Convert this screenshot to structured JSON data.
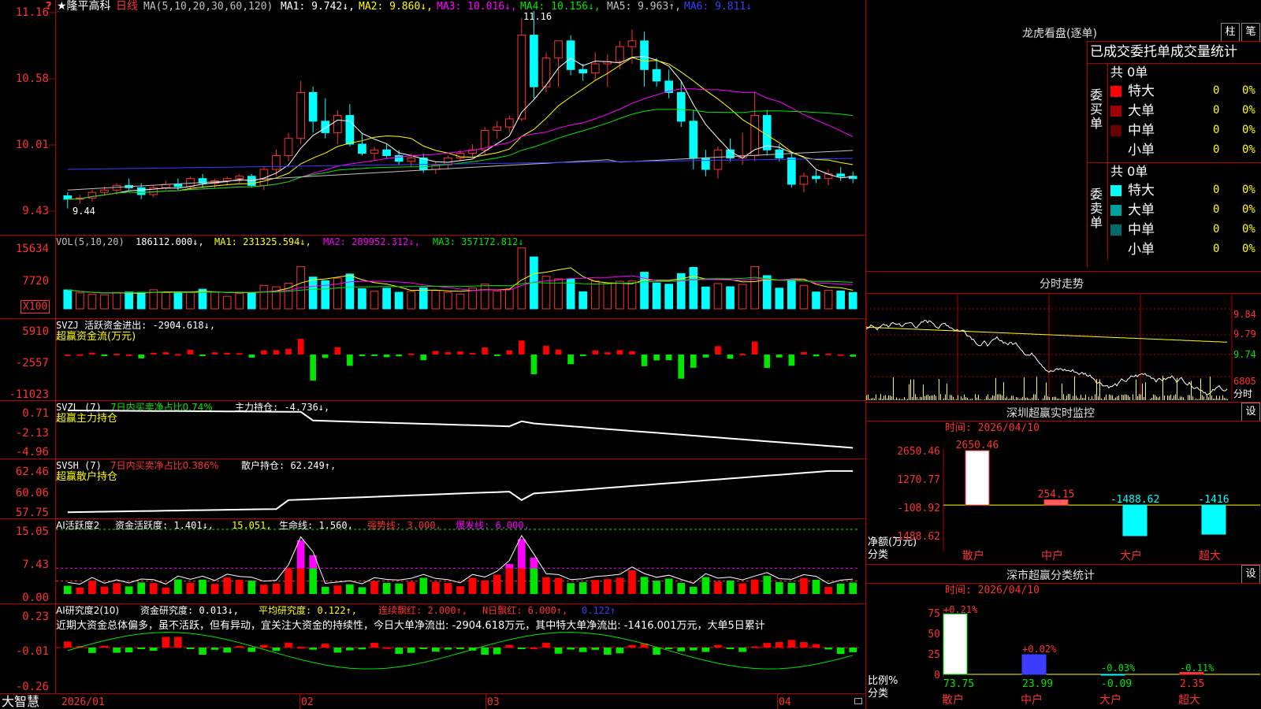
{
  "stock": {
    "name": "★隆平高科",
    "period": "日线"
  },
  "price_header": {
    "ma_params": "MA(5,10,20,30,60,120)",
    "ma1": "MA1: 9.742↓,",
    "ma2": "MA2: 9.860↓,",
    "ma3": "MA3: 10.016↓,",
    "ma4": "MA4: 10.156↓,",
    "ma5": "MA5: 9.963↑,",
    "ma6": "MA6: 9.811↓",
    "ymarks": [
      "11.16",
      "10.58",
      "10.01",
      "9.43"
    ],
    "high_label": "11.16",
    "low_label": "9.44",
    "q_mark": "?"
  },
  "vol_header": {
    "params": "VOL(5,10,20)",
    "vol": "186112.000↓,",
    "ma1": "MA1: 231325.594↓,",
    "ma2": "MA2: 289952.312↓,",
    "ma3": "MA3: 357172.812↓",
    "ymarks": [
      "15634",
      "7720"
    ],
    "unit": "X100"
  },
  "svzj": {
    "line1": "SVZJ  活跃资金进出: -2904.618↓,",
    "line2": "超赢资金流(万元)",
    "ymarks": [
      "5910",
      "-2557",
      "-11023"
    ]
  },
  "svzl": {
    "l1a": "SVZL (7)",
    "l1b": "7日内买卖净占比0.74%",
    "l1c": "主力持仓: -4.736↓,",
    "line2": "超赢主力持仓",
    "ymarks": [
      "0.71",
      "-2.13",
      "-4.96"
    ]
  },
  "svsh": {
    "l1a": "SVSH (7)",
    "l1b": "7日内买卖净占比0.386%",
    "l1c": "散户持仓: 62.249↑,",
    "line2": "超赢散户持仓",
    "ymarks": [
      "62.46",
      "60.06",
      "57.75"
    ]
  },
  "ai_active": {
    "a": "AI活跃度2",
    "b": "资金活跃度: 1.401↓,",
    "c": "15.051,",
    "d": "生命线: 1.560,",
    "e": "强势线: 3.000,",
    "f": "爆发线: 6.000,",
    "ymarks": [
      "15.05",
      "7.43",
      "0.00"
    ]
  },
  "ai_research": {
    "a": "AI研究度2(10)",
    "b": "资金研究度: 0.013↓,",
    "c": "平均研究度: 0.122↑,",
    "d": "连续飘红: 2.000↑,",
    "e": "N日飘红: 6.000↑,",
    "f": "0.122↑",
    "summary": "近期大资金总体偏多，虽不活跃，但有异动，宜关注大资金的持续性，今日大单净流出: -2904.618万元，其中特大单净流出: -1416.001万元，大单5日累计",
    "ymarks": [
      "0.23",
      "-0.01",
      "-0.26"
    ]
  },
  "xaxis": {
    "labels": [
      "2026/01",
      "02",
      "03",
      "04"
    ]
  },
  "brand": "大智慧",
  "right": {
    "dragon": {
      "title": "龙虎看盘(逐单)",
      "tab1": "柱",
      "tab2": "笔",
      "header": "已成交委托单成交量统计",
      "buy_label": "委买单",
      "sell_label": "委卖单",
      "buy_total": "共 0单",
      "sell_total": "共 0单",
      "buy_rows": [
        {
          "name": "特大",
          "val": "0",
          "pct": "0%",
          "color": "#ff0000"
        },
        {
          "name": "大单",
          "val": "0",
          "pct": "0%",
          "color": "#a00000"
        },
        {
          "name": "中单",
          "val": "0",
          "pct": "0%",
          "color": "#6a0000"
        },
        {
          "name": "小单",
          "val": "0",
          "pct": "0%",
          "color": "#000000"
        }
      ],
      "sell_rows": [
        {
          "name": "特大",
          "val": "0",
          "pct": "0%",
          "color": "#00ffff"
        },
        {
          "name": "大单",
          "val": "0",
          "pct": "0%",
          "color": "#00a0a0"
        },
        {
          "name": "中单",
          "val": "0",
          "pct": "0%",
          "color": "#006a6a"
        },
        {
          "name": "小单",
          "val": "0",
          "pct": "0%",
          "color": "#000000"
        }
      ]
    },
    "intraday": {
      "title": "分时走势",
      "ymarks": [
        "9.84",
        "9.79",
        "9.74"
      ],
      "vol": "6805",
      "unit": "分时"
    },
    "monitor": {
      "title": "深圳超赢实时监控",
      "btn": "设",
      "time": "时间: 2026/04/10",
      "ymarks": [
        "2650.46",
        "1270.77",
        "-108.92",
        "-1488.62"
      ],
      "ylabel1": "净额(万元)",
      "ylabel2": "分类",
      "categories": [
        "散户",
        "中户",
        "大户",
        "超大"
      ],
      "values": [
        "2650.46",
        "254.15",
        "-1488.62",
        "-1416"
      ]
    },
    "classify": {
      "title": "深市超赢分类统计",
      "btn": "设",
      "time": "时间: 2026/04/10",
      "ymarks": [
        "75",
        "50",
        "25",
        "0"
      ],
      "ylabel1": "比例%",
      "ylabel2": "分类",
      "categories": [
        "散户",
        "中户",
        "大户",
        "超大"
      ],
      "top": [
        "+0.21%",
        "+0.02%",
        "-0.03%",
        "-0.11%"
      ],
      "bottom": [
        "73.75",
        "23.99",
        "-0.09",
        "2.35"
      ]
    }
  },
  "chart_data": [
    {
      "type": "candlestick",
      "title": "隆平高科 日线",
      "ylim": [
        9.43,
        11.16
      ],
      "ohlc": [
        [
          9.55,
          9.58,
          9.44,
          9.52
        ],
        [
          9.52,
          9.56,
          9.48,
          9.53
        ],
        [
          9.53,
          9.6,
          9.5,
          9.58
        ],
        [
          9.58,
          9.63,
          9.55,
          9.6
        ],
        [
          9.6,
          9.66,
          9.56,
          9.64
        ],
        [
          9.64,
          9.7,
          9.6,
          9.62
        ],
        [
          9.62,
          9.66,
          9.52,
          9.56
        ],
        [
          9.56,
          9.64,
          9.54,
          9.62
        ],
        [
          9.62,
          9.68,
          9.6,
          9.65
        ],
        [
          9.65,
          9.7,
          9.6,
          9.63
        ],
        [
          9.63,
          9.72,
          9.6,
          9.7
        ],
        [
          9.7,
          9.74,
          9.62,
          9.66
        ],
        [
          9.66,
          9.7,
          9.62,
          9.68
        ],
        [
          9.68,
          9.72,
          9.65,
          9.7
        ],
        [
          9.7,
          9.74,
          9.66,
          9.72
        ],
        [
          9.72,
          9.74,
          9.62,
          9.64
        ],
        [
          9.64,
          9.8,
          9.6,
          9.78
        ],
        [
          9.78,
          9.95,
          9.72,
          9.9
        ],
        [
          9.9,
          10.1,
          9.85,
          10.05
        ],
        [
          10.05,
          10.55,
          10.0,
          10.45
        ],
        [
          10.45,
          10.5,
          10.1,
          10.2
        ],
        [
          10.2,
          10.4,
          10.05,
          10.1
        ],
        [
          10.1,
          10.3,
          10.0,
          10.25
        ],
        [
          10.25,
          10.35,
          9.98,
          10.0
        ],
        [
          10.0,
          10.1,
          9.9,
          9.92
        ],
        [
          9.92,
          9.98,
          9.86,
          9.95
        ],
        [
          9.95,
          10.0,
          9.88,
          9.9
        ],
        [
          9.9,
          9.95,
          9.82,
          9.85
        ],
        [
          9.85,
          9.92,
          9.8,
          9.88
        ],
        [
          9.88,
          9.92,
          9.75,
          9.78
        ],
        [
          9.78,
          9.85,
          9.74,
          9.82
        ],
        [
          9.82,
          9.9,
          9.78,
          9.88
        ],
        [
          9.88,
          9.95,
          9.85,
          9.92
        ],
        [
          9.92,
          10.0,
          9.88,
          9.95
        ],
        [
          9.95,
          10.15,
          9.9,
          10.12
        ],
        [
          10.12,
          10.2,
          10.05,
          10.15
        ],
        [
          10.15,
          10.25,
          10.1,
          10.22
        ],
        [
          10.22,
          11.1,
          10.2,
          10.95
        ],
        [
          10.95,
          11.16,
          10.4,
          10.5
        ],
        [
          10.5,
          10.8,
          10.45,
          10.75
        ],
        [
          10.75,
          10.85,
          10.5,
          10.9
        ],
        [
          10.9,
          10.95,
          10.6,
          10.65
        ],
        [
          10.65,
          10.7,
          10.55,
          10.62
        ],
        [
          10.62,
          10.8,
          10.55,
          10.7
        ],
        [
          10.7,
          10.78,
          10.5,
          10.72
        ],
        [
          10.72,
          10.9,
          10.65,
          10.85
        ],
        [
          10.85,
          11.0,
          10.7,
          10.9
        ],
        [
          10.9,
          10.98,
          10.5,
          10.65
        ],
        [
          10.65,
          10.75,
          10.5,
          10.55
        ],
        [
          10.55,
          10.65,
          10.4,
          10.45
        ],
        [
          10.45,
          10.55,
          10.15,
          10.2
        ],
        [
          10.2,
          10.3,
          9.78,
          9.88
        ],
        [
          9.88,
          9.95,
          9.72,
          9.78
        ],
        [
          9.78,
          9.98,
          9.7,
          9.95
        ],
        [
          9.95,
          10.05,
          9.85,
          9.88
        ],
        [
          9.88,
          10.1,
          9.82,
          9.9
        ],
        [
          9.9,
          10.45,
          9.85,
          10.25
        ],
        [
          10.25,
          10.3,
          9.9,
          9.95
        ],
        [
          9.95,
          10.0,
          9.85,
          9.88
        ],
        [
          9.88,
          9.92,
          9.62,
          9.65
        ],
        [
          9.65,
          9.75,
          9.58,
          9.72
        ],
        [
          9.72,
          9.78,
          9.66,
          9.7
        ],
        [
          9.7,
          9.78,
          9.64,
          9.74
        ],
        [
          9.74,
          9.8,
          9.68,
          9.72
        ],
        [
          9.72,
          9.76,
          9.66,
          9.7
        ]
      ]
    },
    {
      "type": "bar",
      "title": "VOL",
      "ylim": [
        0,
        15634
      ]
    },
    {
      "type": "bar",
      "title": "超赢资金流(万元)",
      "ylim": [
        -11023,
        5910
      ]
    },
    {
      "type": "line",
      "title": "超赢主力持仓",
      "ylim": [
        -4.96,
        0.71
      ]
    },
    {
      "type": "line",
      "title": "超赢散户持仓",
      "ylim": [
        57.75,
        62.46
      ]
    },
    {
      "type": "bar",
      "title": "AI活跃度2",
      "ylim": [
        0,
        15.05
      ]
    },
    {
      "type": "bar",
      "title": "AI研究度2(10)",
      "ylim": [
        -0.26,
        0.23
      ]
    },
    {
      "type": "bar",
      "title": "深圳超赢实时监控",
      "categories": [
        "散户",
        "中户",
        "大户",
        "超大"
      ],
      "values": [
        2650.46,
        254.15,
        -1488.62,
        -1416
      ],
      "ylim": [
        -1488.62,
        2650.46
      ]
    },
    {
      "type": "bar",
      "title": "深市超赢分类统计",
      "categories": [
        "散户",
        "中户",
        "大户",
        "超大"
      ],
      "values": [
        73.75,
        23.99,
        -0.09,
        2.35
      ],
      "ylim": [
        0,
        75
      ]
    }
  ]
}
